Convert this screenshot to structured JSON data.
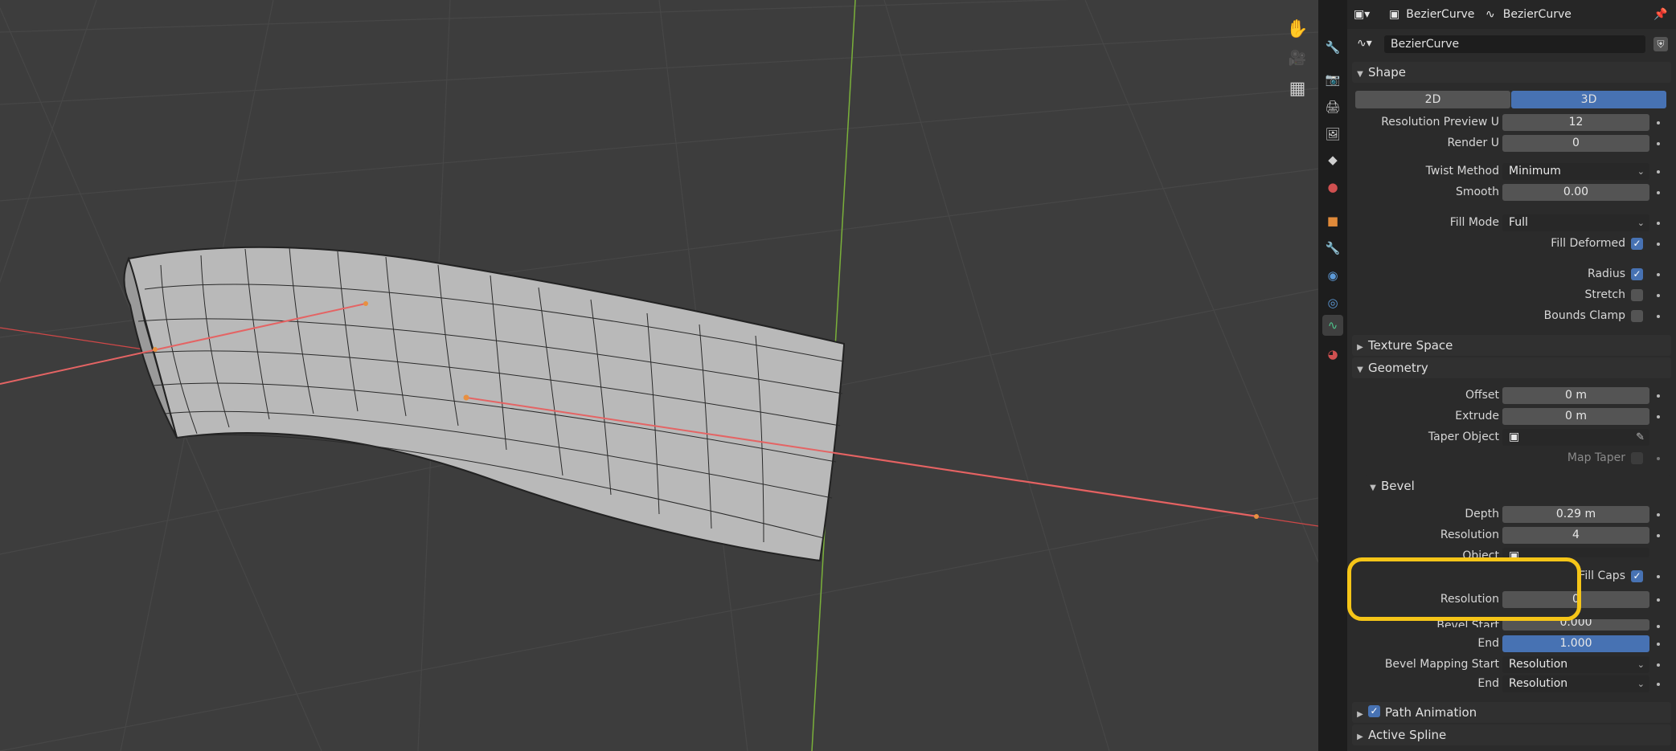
{
  "viewport": {
    "tools": [
      {
        "icon": "hand-pan-icon",
        "glyph": "✋"
      },
      {
        "icon": "camera-icon",
        "glyph": "🎥"
      },
      {
        "icon": "grid-view-icon",
        "glyph": "▦"
      }
    ]
  },
  "header": {
    "object_name": "BezierCurve",
    "data_name": "BezierCurve",
    "datablock_name": "BezierCurve"
  },
  "sidebar": {
    "tabs": [
      "tool-icon",
      "render-icon",
      "output-icon",
      "view-layer-icon",
      "scene-icon",
      "world-icon",
      "object-icon",
      "modifier-icon",
      "particles-icon",
      "physics-icon",
      "curve-data-icon",
      "material-icon"
    ]
  },
  "shape": {
    "title": "Shape",
    "dim_2d": "2D",
    "dim_3d": "3D",
    "resolution_preview_u_label": "Resolution Preview U",
    "resolution_preview_u": "12",
    "render_u_label": "Render U",
    "render_u": "0",
    "twist_method_label": "Twist Method",
    "twist_method": "Minimum",
    "smooth_label": "Smooth",
    "smooth": "0.00",
    "fill_mode_label": "Fill Mode",
    "fill_mode": "Full",
    "fill_deformed_label": "Fill Deformed",
    "radius_label": "Radius",
    "stretch_label": "Stretch",
    "bounds_clamp_label": "Bounds Clamp"
  },
  "texture_space": {
    "title": "Texture Space"
  },
  "geometry": {
    "title": "Geometry",
    "offset_label": "Offset",
    "offset": "0 m",
    "extrude_label": "Extrude",
    "extrude": "0 m",
    "taper_object_label": "Taper Object",
    "map_taper_label": "Map Taper",
    "bevel": {
      "title": "Bevel",
      "depth_label": "Depth",
      "depth": "0.29 m",
      "resolution_label": "Resolution",
      "resolution": "4",
      "object_label": "Object",
      "fill_caps_label": "Fill Caps",
      "caps_resolution_label": "Resolution",
      "caps_resolution": "0",
      "bevel_start_label": "Bevel Start",
      "bevel_start": "0.000",
      "end_label": "End",
      "end": "1.000",
      "mapping_start_label": "Bevel Mapping Start",
      "mapping_start": "Resolution",
      "mapping_end_label": "End",
      "mapping_end": "Resolution"
    }
  },
  "path_animation": {
    "title": "Path Animation"
  },
  "active_spline": {
    "title": "Active Spline"
  },
  "colors": {
    "accent": "#4772b3",
    "highlight": "#f5c518",
    "axis_x": "#e05050",
    "axis_y": "#7ab03a"
  }
}
